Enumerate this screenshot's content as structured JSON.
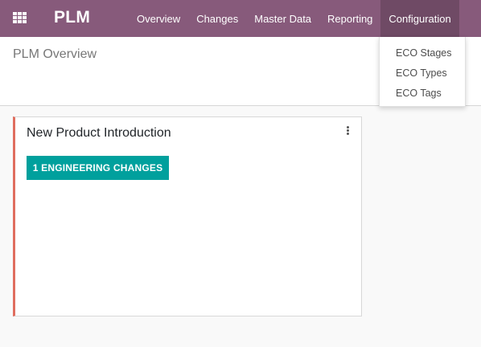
{
  "app": {
    "brand": "PLM"
  },
  "menu": {
    "items": [
      {
        "label": "Overview"
      },
      {
        "label": "Changes"
      },
      {
        "label": "Master Data"
      },
      {
        "label": "Reporting"
      },
      {
        "label": "Configuration"
      }
    ],
    "active": "Configuration"
  },
  "breadcrumb": {
    "title": "PLM Overview"
  },
  "dropdown": {
    "items": [
      {
        "label": "ECO Stages"
      },
      {
        "label": "ECO Types"
      },
      {
        "label": "ECO Tags"
      }
    ]
  },
  "card": {
    "title": "New Product Introduction",
    "button_label": "1 ENGINEERING CHANGES",
    "accent_color": "#e06e5f"
  },
  "colors": {
    "navbar": "#875a7b",
    "active_menu": "#6f4a65",
    "button": "#00a09d"
  },
  "icons": {
    "apps": "grid-icon",
    "card_menu": "vertical-dots-icon"
  }
}
